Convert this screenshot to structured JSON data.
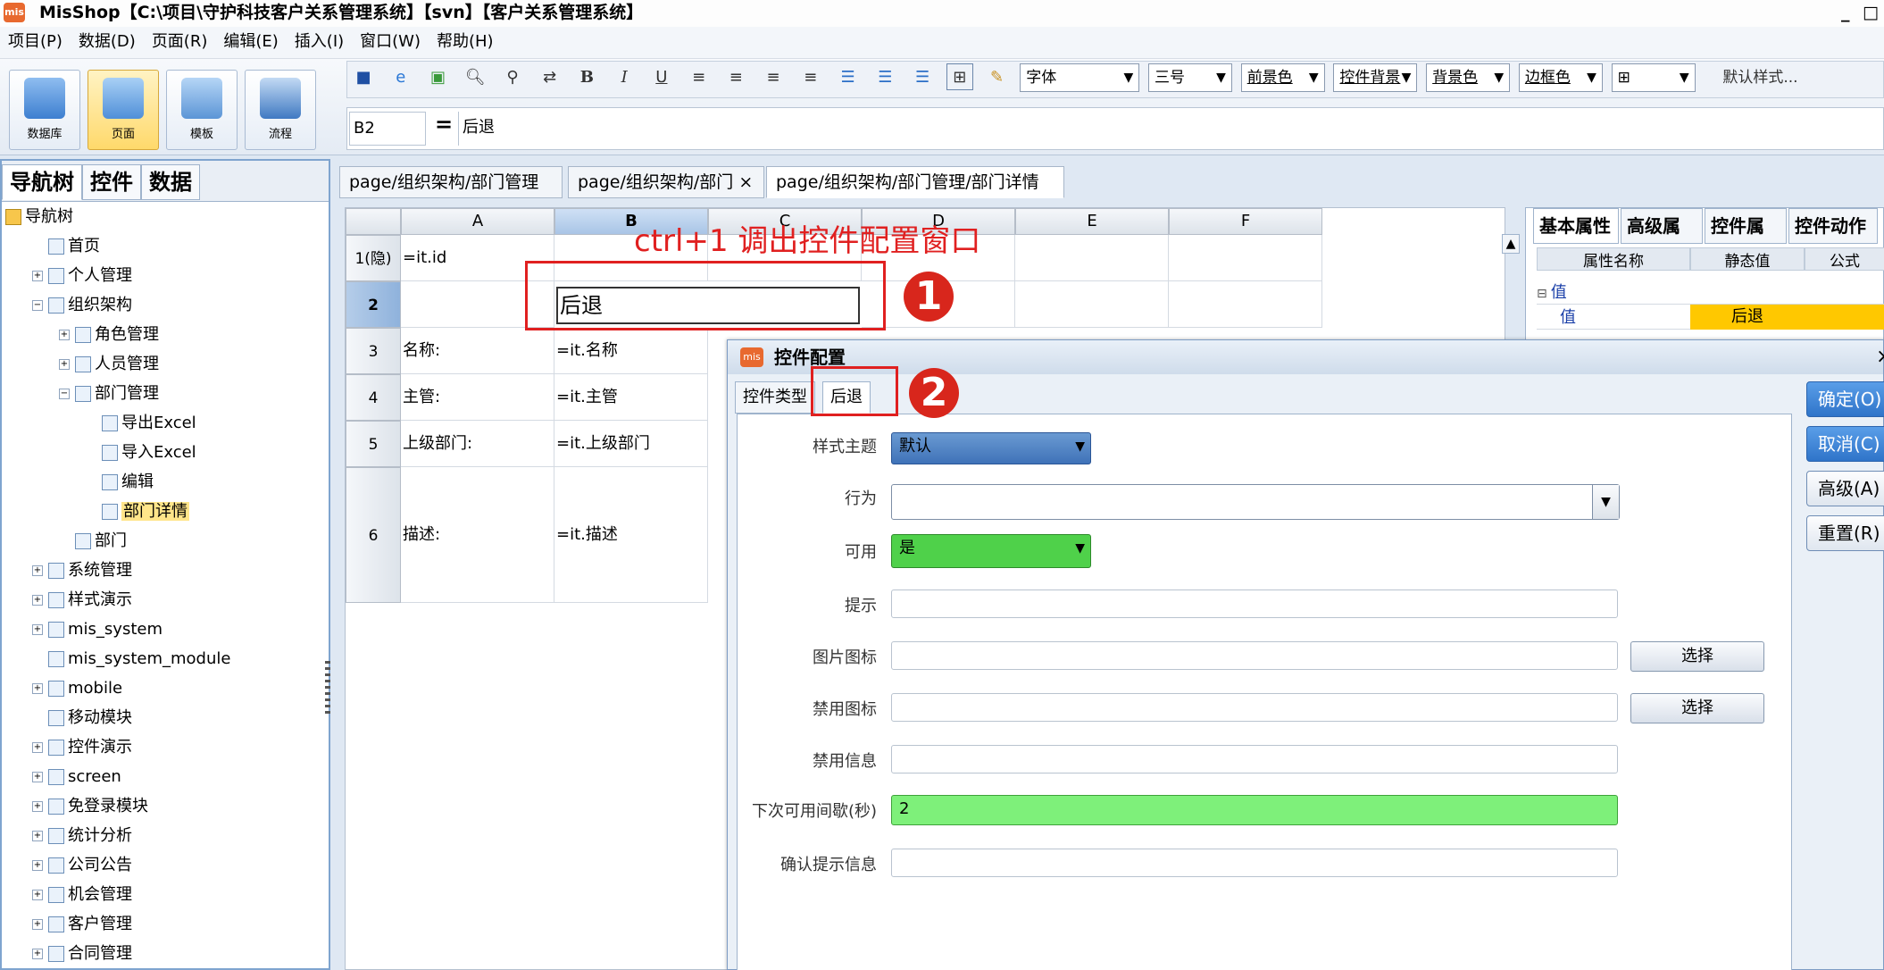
{
  "app": {
    "title": "MisShop【C:\\项目\\守护科技客户关系管理系统】【svn】【客户关系管理系统】",
    "window_controls": [
      "_",
      "□"
    ]
  },
  "menu": [
    "项目(P)",
    "数据(D)",
    "页面(R)",
    "编辑(E)",
    "插入(I)",
    "窗口(W)",
    "帮助(H)"
  ],
  "ribbon": {
    "buttons": [
      {
        "label": "数据库"
      },
      {
        "label": "页面"
      },
      {
        "label": "模板"
      },
      {
        "label": "流程"
      }
    ]
  },
  "toolbar": {
    "icons": [
      "save-icon",
      "ie-icon",
      "preview-icon",
      "print-preview-icon",
      "find-icon",
      "replace-icon"
    ],
    "bold": "B",
    "italic": "I",
    "underline": "U",
    "font_combo": "字体",
    "size_combo": "三号",
    "fore_color": "前景色",
    "control_bg": "控件背景",
    "back_color": "背景色",
    "border_color": "边框色",
    "default_style": "默认样式..."
  },
  "formula_bar": {
    "cell_ref": "B2",
    "equals": "=",
    "value": "后退"
  },
  "left_panel": {
    "tabs": [
      "导航树",
      "控件",
      "数据"
    ],
    "tree": [
      {
        "label": "导航树",
        "level": 0
      },
      {
        "label": "首页",
        "level": 1
      },
      {
        "label": "个人管理",
        "level": 1
      },
      {
        "label": "组织架构",
        "level": 1
      },
      {
        "label": "角色管理",
        "level": 2
      },
      {
        "label": "人员管理",
        "level": 2
      },
      {
        "label": "部门管理",
        "level": 2
      },
      {
        "label": "导出Excel",
        "level": 3
      },
      {
        "label": "导入Excel",
        "level": 3
      },
      {
        "label": "编辑",
        "level": 3
      },
      {
        "label": "部门详情",
        "level": 3
      },
      {
        "label": "部门",
        "level": 2
      },
      {
        "label": "系统管理",
        "level": 1
      },
      {
        "label": "样式演示",
        "level": 1
      },
      {
        "label": "mis_system",
        "level": 1
      },
      {
        "label": "mis_system_module",
        "level": 1
      },
      {
        "label": "mobile",
        "level": 1
      },
      {
        "label": "移动模块",
        "level": 1
      },
      {
        "label": "控件演示",
        "level": 1
      },
      {
        "label": "screen",
        "level": 1
      },
      {
        "label": "免登录模块",
        "level": 1
      },
      {
        "label": "统计分析",
        "level": 1
      },
      {
        "label": "公司公告",
        "level": 1
      },
      {
        "label": "机会管理",
        "level": 1
      },
      {
        "label": "客户管理",
        "level": 1
      },
      {
        "label": "合同管理",
        "level": 1
      }
    ]
  },
  "doc_tabs": [
    "page/组织架构/部门管理",
    "page/组织架构/部门",
    "page/组织架构/部门管理/部门详情"
  ],
  "sheet": {
    "columns": [
      "A",
      "B",
      "C",
      "D",
      "E",
      "F"
    ],
    "rows": [
      {
        "head": "1(隐)",
        "a": "=it.id",
        "b": ""
      },
      {
        "head": "2",
        "a": "",
        "b": "后退"
      },
      {
        "head": "3",
        "a": "名称:",
        "b": "=it.名称"
      },
      {
        "head": "4",
        "a": "主管:",
        "b": "=it.主管"
      },
      {
        "head": "5",
        "a": "上级部门:",
        "b": "=it.上级部门"
      },
      {
        "head": "6",
        "a": "描述:",
        "b": "=it.描述"
      }
    ]
  },
  "annotation": {
    "text": "ctrl+1 调出控件配置窗口",
    "step1": "1",
    "step2": "2"
  },
  "right_panel": {
    "tabs": [
      "基本属性",
      "高级属性",
      "控件属性",
      "控件动作"
    ],
    "headers": [
      "属性名称",
      "静态值",
      "公式"
    ],
    "rows": [
      {
        "name": "值",
        "static": "",
        "formula": ""
      },
      {
        "name": "值",
        "static": "后退",
        "formula": ""
      }
    ]
  },
  "dialog": {
    "title": "控件配置",
    "close": "×",
    "tabs": [
      "控件类型",
      "后退"
    ],
    "fields": {
      "style_theme": {
        "label": "样式主题",
        "value": "默认"
      },
      "behavior": {
        "label": "行为",
        "value": ""
      },
      "enabled": {
        "label": "可用",
        "value": "是"
      },
      "hint": {
        "label": "提示",
        "value": ""
      },
      "image_icon": {
        "label": "图片图标",
        "value": "",
        "button": "选择"
      },
      "disabled_icon": {
        "label": "禁用图标",
        "value": "",
        "button": "选择"
      },
      "disabled_info": {
        "label": "禁用信息",
        "value": ""
      },
      "next_interval": {
        "label": "下次可用间歇(秒)",
        "value": "2"
      },
      "confirm_msg": {
        "label": "确认提示信息",
        "value": ""
      }
    },
    "buttons": {
      "ok": "确定(O)",
      "cancel": "取消(C)",
      "advanced": "高级(A)",
      "reset": "重置(R)"
    }
  },
  "colors": {
    "accent": "#2f74c9",
    "selection": "#ffe58a",
    "highlight_green": "#7ef07a",
    "annotation_red": "#e02020"
  }
}
